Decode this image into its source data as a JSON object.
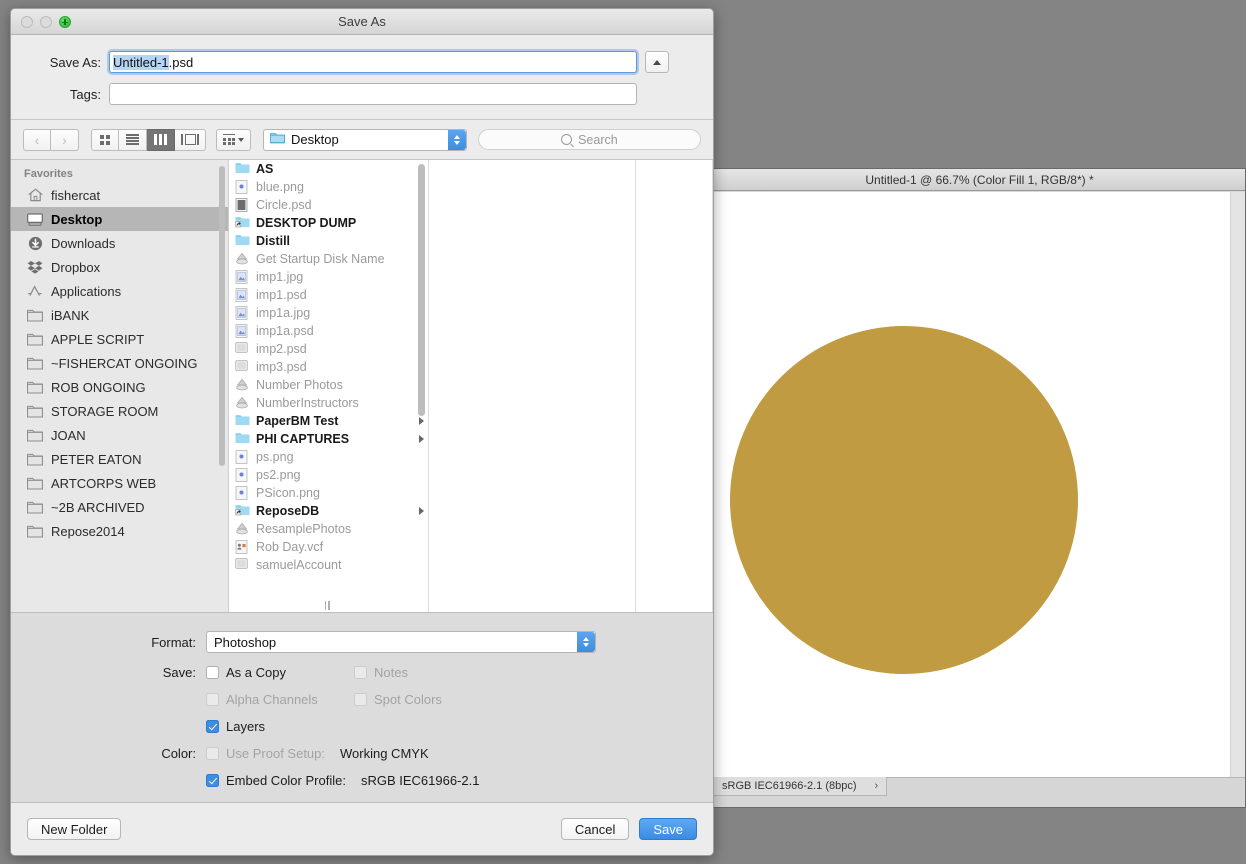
{
  "photoshop_window": {
    "title": "Untitled-1 @ 66.7% (Color Fill 1, RGB/8*) *",
    "status_text": "sRGB IEC61966-2.1 (8bpc)",
    "status_chevron": "›",
    "circle_color": "#c09b42",
    "canvas_color": "#ffffff"
  },
  "dialog": {
    "title": "Save As",
    "window_controls": [
      {
        "name": "close",
        "state": "disabled"
      },
      {
        "name": "minimize",
        "state": "disabled"
      },
      {
        "name": "zoom",
        "state": "enabled"
      }
    ],
    "fields": {
      "save_as_label": "Save As:",
      "save_as_value": "Untitled-1.psd",
      "save_as_selected": "Untitled-1",
      "save_as_unselected": ".psd",
      "tags_label": "Tags:",
      "tags_value": "",
      "tags_placeholder": ""
    },
    "toolbar": {
      "back_label": "‹",
      "forward_label": "›",
      "view_modes": [
        {
          "name": "icon-view",
          "selected": false
        },
        {
          "name": "list-view",
          "selected": false
        },
        {
          "name": "column-view",
          "selected": true
        },
        {
          "name": "coverflow-view",
          "selected": false
        }
      ],
      "arrange_label": "",
      "path_value": "Desktop",
      "search_placeholder": "Search"
    },
    "sidebar": {
      "header": "Favorites",
      "items": [
        {
          "label": "fishercat",
          "icon": "home-icon",
          "selected": false
        },
        {
          "label": "Desktop",
          "icon": "desktop-icon",
          "selected": true
        },
        {
          "label": "Downloads",
          "icon": "downloads-icon",
          "selected": false
        },
        {
          "label": "Dropbox",
          "icon": "dropbox-icon",
          "selected": false
        },
        {
          "label": "Applications",
          "icon": "applications-icon",
          "selected": false
        },
        {
          "label": "iBANK",
          "icon": "folder-icon",
          "selected": false
        },
        {
          "label": "APPLE SCRIPT",
          "icon": "folder-icon",
          "selected": false
        },
        {
          "label": "~FISHERCAT ONGOING",
          "icon": "folder-icon",
          "selected": false
        },
        {
          "label": "ROB ONGOING",
          "icon": "folder-icon",
          "selected": false
        },
        {
          "label": "STORAGE ROOM",
          "icon": "folder-icon",
          "selected": false
        },
        {
          "label": "JOAN",
          "icon": "folder-icon",
          "selected": false
        },
        {
          "label": "PETER EATON",
          "icon": "folder-icon",
          "selected": false
        },
        {
          "label": "ARTCORPS WEB",
          "icon": "folder-icon",
          "selected": false
        },
        {
          "label": "~2B ARCHIVED",
          "icon": "folder-icon",
          "selected": false
        },
        {
          "label": "Repose2014",
          "icon": "folder-icon",
          "selected": false
        }
      ]
    },
    "file_list": [
      {
        "name": "AS",
        "type": "folder",
        "has_children": true
      },
      {
        "name": "blue.png",
        "type": "image-png",
        "has_children": false
      },
      {
        "name": "Circle.psd",
        "type": "photoshop-doc",
        "has_children": false
      },
      {
        "name": "DESKTOP DUMP",
        "type": "folder-alias",
        "has_children": true
      },
      {
        "name": "Distill",
        "type": "folder",
        "has_children": true
      },
      {
        "name": "Get Startup Disk Name",
        "type": "applescript",
        "has_children": false
      },
      {
        "name": "imp1.jpg",
        "type": "image-jpg",
        "has_children": false
      },
      {
        "name": "imp1.psd",
        "type": "image-jpg",
        "has_children": false
      },
      {
        "name": "imp1a.jpg",
        "type": "image-jpg",
        "has_children": false
      },
      {
        "name": "imp1a.psd",
        "type": "image-jpg",
        "has_children": false
      },
      {
        "name": "imp2.psd",
        "type": "document",
        "has_children": false
      },
      {
        "name": "imp3.psd",
        "type": "document",
        "has_children": false
      },
      {
        "name": "Number Photos",
        "type": "applescript",
        "has_children": false
      },
      {
        "name": "NumberInstructors",
        "type": "applescript",
        "has_children": false
      },
      {
        "name": "PaperBM Test",
        "type": "folder",
        "has_children": true
      },
      {
        "name": "PHI CAPTURES",
        "type": "folder",
        "has_children": true
      },
      {
        "name": "ps.png",
        "type": "image-png",
        "has_children": false
      },
      {
        "name": "ps2.png",
        "type": "image-png",
        "has_children": false
      },
      {
        "name": "PSicon.png",
        "type": "image-png",
        "has_children": false
      },
      {
        "name": "ReposeDB",
        "type": "folder-alias",
        "has_children": true
      },
      {
        "name": "ResamplePhotos",
        "type": "applescript",
        "has_children": false
      },
      {
        "name": "Rob Day.vcf",
        "type": "vcard",
        "has_children": false
      },
      {
        "name": "samuelAccount",
        "type": "document",
        "has_children": false
      }
    ],
    "options": {
      "format_label": "Format:",
      "format_value": "Photoshop",
      "save_label": "Save:",
      "color_label": "Color:",
      "checkboxes": [
        {
          "label": "As a Copy",
          "checked": false,
          "disabled": false
        },
        {
          "label": "Notes",
          "checked": false,
          "disabled": true
        },
        {
          "label": "Alpha Channels",
          "checked": false,
          "disabled": true
        },
        {
          "label": "Spot Colors",
          "checked": false,
          "disabled": true
        },
        {
          "label": "Layers",
          "checked": true,
          "disabled": false
        },
        {
          "label": "Use Proof Setup:",
          "checked": false,
          "disabled": true,
          "value": "Working CMYK"
        },
        {
          "label": "Embed Color Profile:",
          "checked": true,
          "disabled": false,
          "value": "sRGB IEC61966-2.1"
        }
      ]
    },
    "buttons": {
      "new_folder": "New Folder",
      "cancel": "Cancel",
      "save": "Save"
    }
  },
  "colors": {
    "accent": "#3d8ee0",
    "desktop": "#848484",
    "sheet_bg": "#ececec",
    "options_bg": "#dcdcdc",
    "folder_blue": "#79c9ea"
  }
}
